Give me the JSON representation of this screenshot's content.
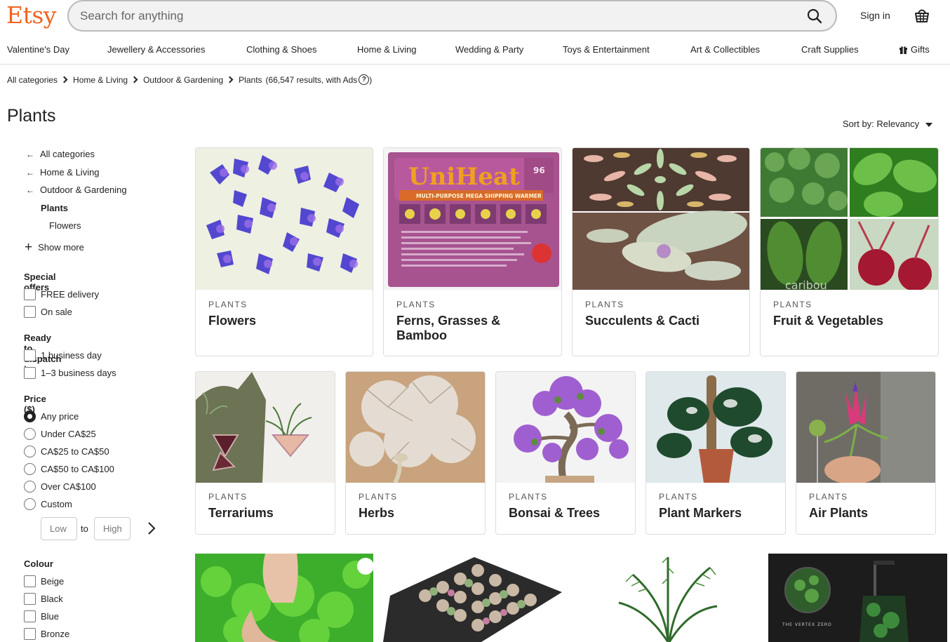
{
  "header": {
    "logo": "Etsy",
    "search_placeholder": "Search for anything",
    "signin": "Sign in"
  },
  "nav": [
    "Valentine's Day",
    "Jewellery & Accessories",
    "Clothing & Shoes",
    "Home & Living",
    "Wedding & Party",
    "Toys & Entertainment",
    "Art & Collectibles",
    "Craft Supplies",
    "Gifts"
  ],
  "breadcrumb": {
    "items": [
      "All categories",
      "Home & Living",
      "Outdoor & Gardening",
      "Plants"
    ],
    "results": "(66,547 results, with Ads",
    "close": ")"
  },
  "page": {
    "title": "Plants",
    "sort_label": "Sort by: Relevancy"
  },
  "sidebar": {
    "categories": [
      "All categories",
      "Home & Living",
      "Outdoor & Gardening",
      "Plants",
      "Flowers"
    ],
    "show_more": "Show more",
    "special_offers": {
      "title": "Special offers",
      "options": [
        "FREE delivery",
        "On sale"
      ]
    },
    "dispatch": {
      "title": "Ready to dispatch in",
      "options": [
        "1 business day",
        "1–3 business days"
      ]
    },
    "price": {
      "title": "Price ($)",
      "options": [
        "Any price",
        "Under CA$25",
        "CA$25 to CA$50",
        "CA$50 to CA$100",
        "Over CA$100",
        "Custom"
      ],
      "selected": "Any price",
      "low_placeholder": "Low",
      "to": "to",
      "high_placeholder": "High"
    },
    "colour": {
      "title": "Colour",
      "options": [
        "Beige",
        "Black",
        "Blue",
        "Bronze"
      ]
    }
  },
  "cards_row1": [
    {
      "kicker": "PLANTS",
      "name": "Flowers"
    },
    {
      "kicker": "PLANTS",
      "name": "Ferns, Grasses & Bamboo"
    },
    {
      "kicker": "PLANTS",
      "name": "Succulents & Cacti"
    },
    {
      "kicker": "PLANTS",
      "name": "Fruit & Vegetables"
    }
  ],
  "cards_row2": [
    {
      "kicker": "PLANTS",
      "name": "Terrariums"
    },
    {
      "kicker": "PLANTS",
      "name": "Herbs"
    },
    {
      "kicker": "PLANTS",
      "name": "Bonsai & Trees"
    },
    {
      "kicker": "PLANTS",
      "name": "Plant Markers"
    },
    {
      "kicker": "PLANTS",
      "name": "Air Plants"
    }
  ],
  "product_labels": {
    "uniheat_brand": "UniHeat",
    "uniheat_hours": "96",
    "uniheat_sub": "MULTI-PURPOSE MEGA SHIPPING WARMER",
    "caribou": "caribou",
    "vertex_line1": "THE VERTEX ZERO"
  },
  "colors": {
    "brand": "#F1641E",
    "text": "#222222",
    "border": "#dddddd"
  }
}
